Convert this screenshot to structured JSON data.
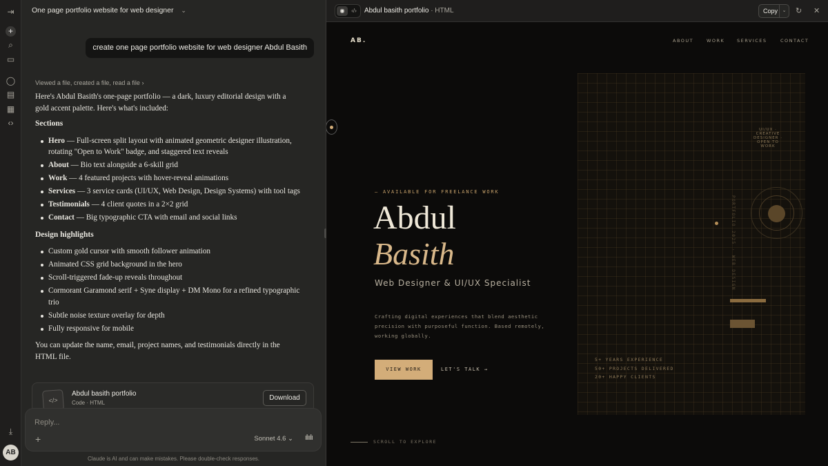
{
  "chat": {
    "title": "One page portfolio website for web designer",
    "user_message": "create one page portfolio website for web designer Abdul Basith",
    "tool_summary": "Viewed a file, created a file, read a file",
    "intro": "Here's Abdul Basith's one-page portfolio — a dark, luxury editorial design with a gold accent palette. Here's what's included:",
    "sections_heading": "Sections",
    "sections": [
      {
        "name": "Hero",
        "text": " — Full-screen split layout with animated geometric designer illustration, rotating \"Open to Work\" badge, and staggered text reveals"
      },
      {
        "name": "About",
        "text": " — Bio text alongside a 6-skill grid"
      },
      {
        "name": "Work",
        "text": " — 4 featured projects with hover-reveal animations"
      },
      {
        "name": "Services",
        "text": " — 3 service cards (UI/UX, Web Design, Design Systems) with tool tags"
      },
      {
        "name": "Testimonials",
        "text": " — 4 client quotes in a 2×2 grid"
      },
      {
        "name": "Contact",
        "text": " — Big typographic CTA with email and social links"
      }
    ],
    "highlights_heading": "Design highlights",
    "highlights": [
      "Custom gold cursor with smooth follower animation",
      "Animated CSS grid background in the hero",
      "Scroll-triggered fade-up reveals throughout",
      "Cormorant Garamond serif + Syne display + DM Mono for a refined typographic trio",
      "Subtle noise texture overlay for depth",
      "Fully responsive for mobile"
    ],
    "outro": "You can update the name, email, project names, and testimonials directly in the HTML file.",
    "artifact_name": "Abdul basith portfolio",
    "artifact_meta": "Code · HTML",
    "download_label": "Download",
    "reply_placeholder": "Reply...",
    "model": "Sonnet 4.6",
    "disclaimer": "Claude is AI and can make mistakes. Please double-check responses.",
    "avatar": "AB"
  },
  "panel": {
    "title": "Abdul basith portfolio",
    "subtitle": "· HTML",
    "copy_label": "Copy"
  },
  "site": {
    "logo": "AB.",
    "nav": [
      "ABOUT",
      "WORK",
      "SERVICES",
      "CONTACT"
    ],
    "available": "— AVAILABLE FOR FREELANCE WORK",
    "first_name": "Abdul",
    "last_name": "Basith",
    "role": "Web Designer & UI/UX Specialist",
    "description": "Crafting digital experiences that blend aesthetic precision with purposeful function. Based remotely, working globally.",
    "cta_primary": "VIEW WORK",
    "cta_secondary": "LET'S TALK →",
    "scroll_hint": "SCROLL TO EXPLORE",
    "stats": [
      "5+ YEARS EXPERIENCE",
      "50+ PROJECTS DELIVERED",
      "20+ HAPPY CLIENTS"
    ],
    "badge": "UI/UX · CREATIVE DESIGNER · OPEN TO WORK",
    "vertical_text": "PORTFOLIO 2025 · WEB DESIGN"
  },
  "colors": {
    "gold": "#d3ad79",
    "background": "#0c0b0a",
    "chat_bg": "#262624"
  }
}
